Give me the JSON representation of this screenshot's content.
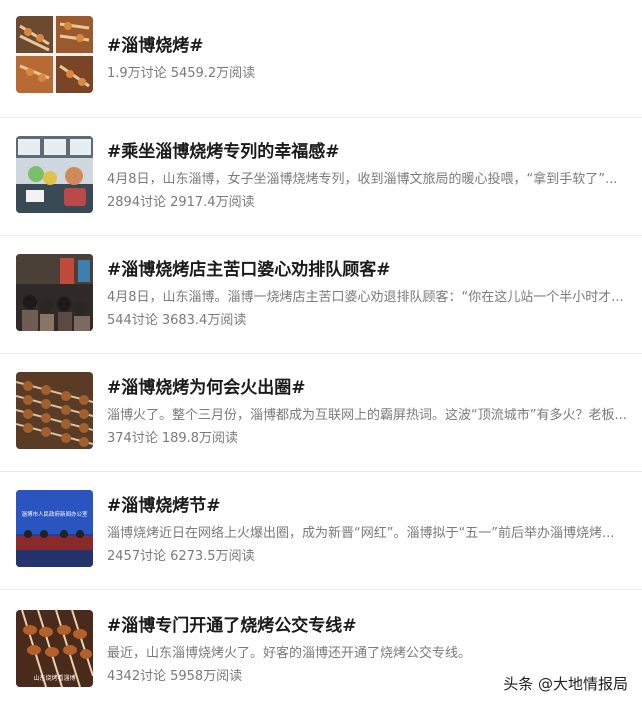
{
  "topics": [
    {
      "title": "#淄博烧烤#",
      "description": "",
      "discussions": "1.9万讨论",
      "reads": "5459.2万阅读"
    },
    {
      "title": "#乘坐淄博烧烤专列的幸福感#",
      "description": "4月8日，山东淄博，女子坐淄博烧烤专列，收到淄博文旅局的暖心投喂，“拿到手软了”...",
      "discussions": "2894讨论",
      "reads": "2917.4万阅读"
    },
    {
      "title": "#淄博烧烤店主苦口婆心劝排队顾客#",
      "description": "4月8日，山东淄博。淄博一烧烤店主苦口婆心劝退排队顾客：“你在这儿站一个半小时才...",
      "discussions": "544讨论",
      "reads": "3683.4万阅读"
    },
    {
      "title": "#淄博烧烤为何会火出圈#",
      "description": "淄博火了。整个三月份，淄博都成为互联网上的霸屏热词。这波“顶流城市”有多火？老板...",
      "discussions": "374讨论",
      "reads": "189.8万阅读"
    },
    {
      "title": "#淄博烧烤节#",
      "description": "淄博烧烤近日在网络上火爆出圈，成为新晋“网红”。淄博拟于“五一”前后举办淄博烧烤...",
      "discussions": "2457讨论",
      "reads": "6273.5万阅读"
    },
    {
      "title": "#淄博专门开通了烧烤公交专线#",
      "description": "最近，山东淄博烧烤火了。好客的淄博还开通了烧烤公交专线。",
      "discussions": "4342讨论",
      "reads": "5958万阅读"
    }
  ],
  "watermark": "头条 @大地情报局",
  "thumb_captions": {
    "press_banner": "淄博市人民政府新闻办公室",
    "food_label": "山东烧烤看淄博"
  }
}
